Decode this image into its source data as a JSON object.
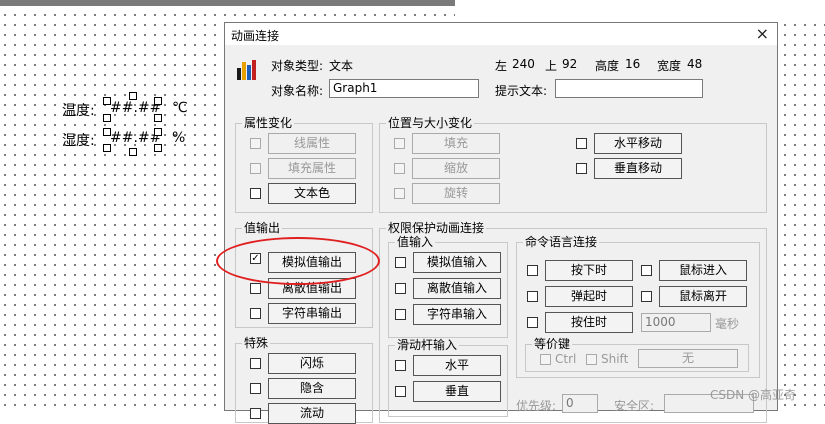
{
  "canvas": {
    "temp_label": "温度:",
    "temp_value": "##.##",
    "temp_unit": "℃",
    "humid_label": "湿度:",
    "humid_value": "##.##",
    "humid_unit": "%"
  },
  "dialog": {
    "title": "动画连接",
    "close_glyph": "×",
    "object_type_label": "对象类型:",
    "object_type_value": "文本",
    "object_name_label": "对象名称:",
    "object_name_value": "Graph1",
    "left_label": "左",
    "left_value": "240",
    "top_label": "上",
    "top_value": "92",
    "height_label": "高度",
    "height_value": "16",
    "width_label": "宽度",
    "width_value": "48",
    "hint_label": "提示文本:",
    "hint_value": ""
  },
  "property_group": {
    "title": "属性变化",
    "items": [
      {
        "label": "线属性",
        "checked": false,
        "enabled": false
      },
      {
        "label": "填充属性",
        "checked": false,
        "enabled": false
      },
      {
        "label": "文本色",
        "checked": false,
        "enabled": true
      }
    ]
  },
  "position_group": {
    "title": "位置与大小变化",
    "left_items": [
      {
        "label": "填充",
        "enabled": false
      },
      {
        "label": "缩放",
        "enabled": false
      },
      {
        "label": "旋转",
        "enabled": false
      }
    ],
    "right_items": [
      {
        "label": "水平移动",
        "enabled": true
      },
      {
        "label": "垂直移动",
        "enabled": true
      }
    ]
  },
  "output_group": {
    "title": "值输出",
    "items": [
      {
        "label": "模拟值输出",
        "checked": true,
        "check_glyph": "✓"
      },
      {
        "label": "离散值输出",
        "checked": false
      },
      {
        "label": "字符串输出",
        "checked": false
      }
    ]
  },
  "special_group": {
    "title": "特殊",
    "items": [
      {
        "label": "闪烁"
      },
      {
        "label": "隐含"
      },
      {
        "label": "流动"
      }
    ]
  },
  "permission_group": {
    "title": "权限保护动画连接",
    "input_title": "值输入",
    "input_items": [
      {
        "label": "模拟值输入"
      },
      {
        "label": "离散值输入"
      },
      {
        "label": "字符串输入"
      }
    ],
    "slider_title": "滑动杆输入",
    "slider_items": [
      {
        "label": "水平"
      },
      {
        "label": "垂直"
      }
    ],
    "priority_label": "优先级:",
    "priority_value": "0",
    "security_label": "安全区:"
  },
  "command_group": {
    "title": "命令语言连接",
    "left_items": [
      {
        "label": "按下时"
      },
      {
        "label": "弹起时"
      },
      {
        "label": "按住时"
      }
    ],
    "right_items": [
      {
        "label": "鼠标进入"
      },
      {
        "label": "鼠标离开"
      }
    ],
    "interval_value": "1000",
    "interval_unit": "毫秒",
    "hotkey_title": "等价键",
    "ctrl_label": "Ctrl",
    "shift_label": "Shift",
    "none_label": "无"
  },
  "watermark": "CSDN @高亚奇"
}
